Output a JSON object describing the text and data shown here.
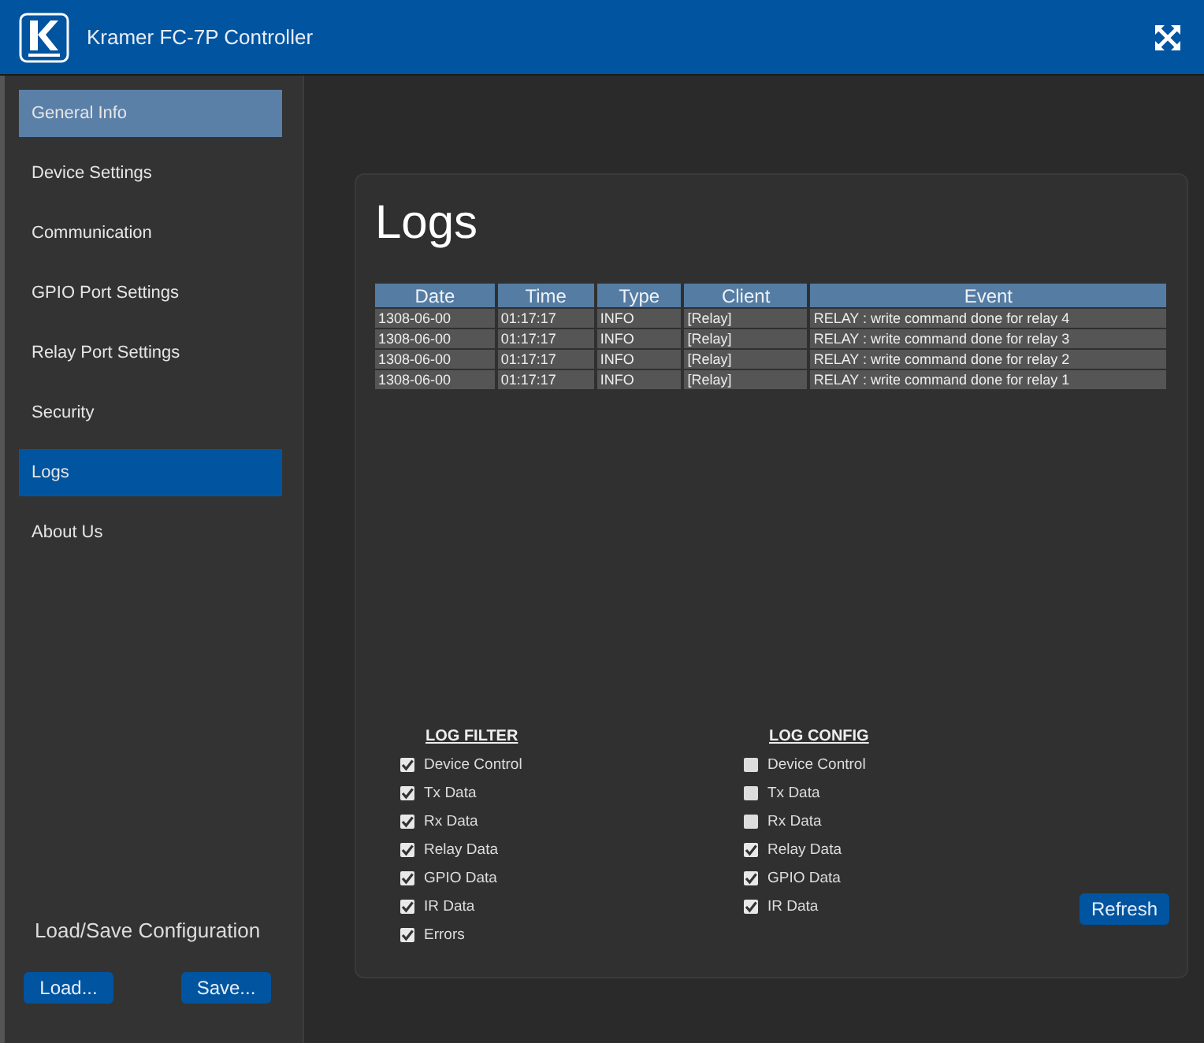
{
  "window": {
    "title": "Kramer FC-7P Controller"
  },
  "sidebar": {
    "items": [
      {
        "label": "General Info",
        "selected": false,
        "hovered": true
      },
      {
        "label": "Device Settings",
        "selected": false,
        "hovered": false
      },
      {
        "label": "Communication",
        "selected": false,
        "hovered": false
      },
      {
        "label": "GPIO Port Settings",
        "selected": false,
        "hovered": false
      },
      {
        "label": "Relay Port Settings",
        "selected": false,
        "hovered": false
      },
      {
        "label": "Security",
        "selected": false,
        "hovered": false
      },
      {
        "label": "Logs",
        "selected": true,
        "hovered": false
      },
      {
        "label": "About Us",
        "selected": false,
        "hovered": false
      }
    ],
    "load_save": {
      "title": "Load/Save Configuration",
      "buttons": [
        "Load...",
        "Save..."
      ]
    }
  },
  "page": {
    "title": "Logs",
    "table": {
      "columns": [
        "Date",
        "Time",
        "Type",
        "Client",
        "Event"
      ],
      "rows": [
        [
          "1308-06-00",
          "01:17:17",
          "INFO",
          "[Relay]",
          "RELAY : write command done for relay 4"
        ],
        [
          "1308-06-00",
          "01:17:17",
          "INFO",
          "[Relay]",
          "RELAY : write command done for relay 3"
        ],
        [
          "1308-06-00",
          "01:17:17",
          "INFO",
          "[Relay]",
          "RELAY : write command done for relay 2"
        ],
        [
          "1308-06-00",
          "01:17:17",
          "INFO",
          "[Relay]",
          "RELAY : write command done for relay 1"
        ]
      ]
    },
    "log_filter": {
      "title": "LOG FILTER",
      "items": [
        {
          "label": "Device Control",
          "checked": true
        },
        {
          "label": "Tx Data",
          "checked": true
        },
        {
          "label": "Rx Data",
          "checked": true
        },
        {
          "label": "Relay Data",
          "checked": true
        },
        {
          "label": "GPIO Data",
          "checked": true
        },
        {
          "label": "IR Data",
          "checked": true
        },
        {
          "label": "Errors",
          "checked": true
        }
      ]
    },
    "log_config": {
      "title": "LOG CONFIG",
      "items": [
        {
          "label": "Device Control",
          "checked": false
        },
        {
          "label": "Tx Data",
          "checked": false
        },
        {
          "label": "Rx Data",
          "checked": false
        },
        {
          "label": "Relay Data",
          "checked": true
        },
        {
          "label": "GPIO Data",
          "checked": true
        },
        {
          "label": "IR Data",
          "checked": true
        }
      ]
    },
    "refresh_button": "Refresh"
  }
}
